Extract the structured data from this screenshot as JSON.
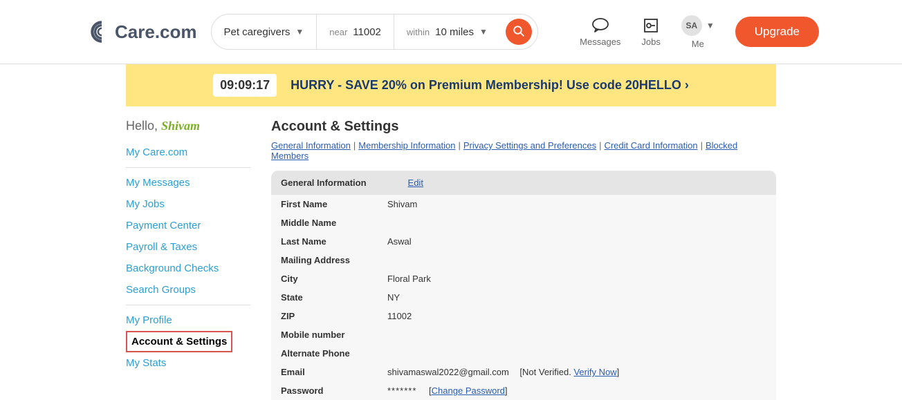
{
  "logo_text": "Care.com",
  "search": {
    "category": "Pet caregivers",
    "near_label": "near",
    "near_value": "11002",
    "within_label": "within",
    "within_value": "10 miles"
  },
  "header_icons": {
    "messages": "Messages",
    "jobs": "Jobs",
    "me": "Me",
    "avatar_initials": "SA"
  },
  "upgrade_label": "Upgrade",
  "promo": {
    "timer": "09:09:17",
    "text": "HURRY - SAVE 20% on Premium Membership! Use code 20HELLO ›"
  },
  "sidebar": {
    "hello_prefix": "Hello, ",
    "hello_name": "Shivam",
    "items_top": [
      "My Care.com"
    ],
    "items_mid": [
      "My Messages",
      "My Jobs",
      "Payment Center",
      "Payroll & Taxes",
      "Background Checks",
      "Search Groups"
    ],
    "items_bot": [
      "My Profile",
      "Account & Settings",
      "My Stats"
    ],
    "active": "Account & Settings"
  },
  "main": {
    "title": "Account & Settings",
    "tabs": [
      "General Information",
      "Membership Information",
      "Privacy Settings and Preferences",
      "Credit Card Information",
      "Blocked Members"
    ],
    "info_section_title": "General Information",
    "edit_label": "Edit",
    "fields": {
      "first_name_label": "First Name",
      "first_name_value": "Shivam",
      "middle_name_label": "Middle Name",
      "middle_name_value": "",
      "last_name_label": "Last Name",
      "last_name_value": "Aswal",
      "mailing_address_label": "Mailing Address",
      "mailing_address_value": "",
      "city_label": "City",
      "city_value": "Floral Park",
      "state_label": "State",
      "state_value": "NY",
      "zip_label": "ZIP",
      "zip_value": "11002",
      "mobile_label": "Mobile number",
      "mobile_value": "",
      "alt_phone_label": "Alternate Phone",
      "alt_phone_value": "",
      "email_label": "Email",
      "email_value": "shivamaswal2022@gmail.com",
      "email_not_verified": "[Not Verified. ",
      "email_verify_link": "Verify Now",
      "email_close_bracket": "]",
      "password_label": "Password",
      "password_value": "*******",
      "change_password_open": "[",
      "change_password_link": "Change Password",
      "change_password_close": "]"
    }
  }
}
